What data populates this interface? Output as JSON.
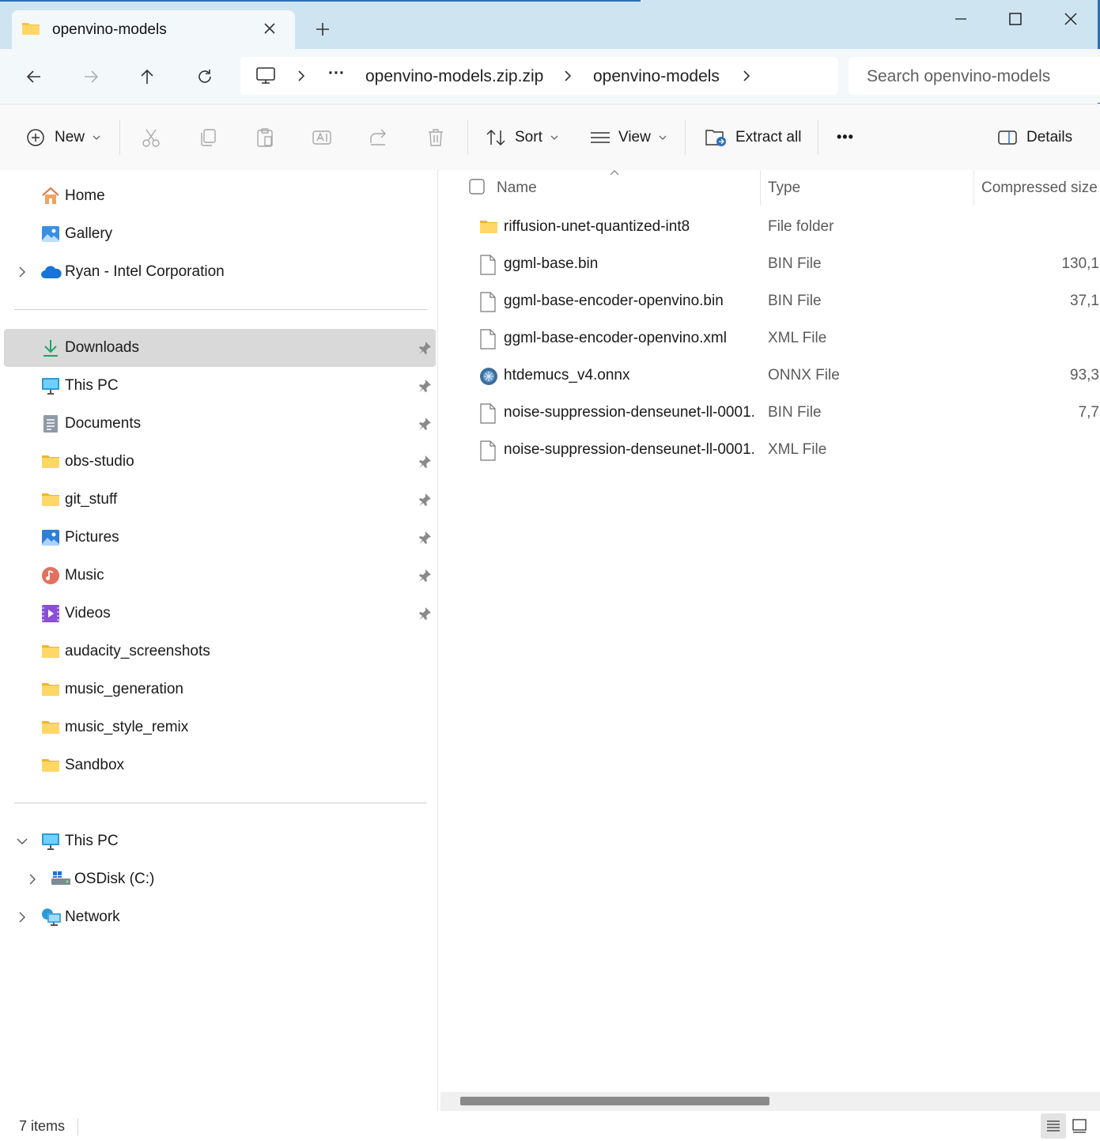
{
  "window": {
    "tab_title": "openvino-models",
    "new_tab_symbol": "+",
    "controls": [
      "minimize-icon",
      "maximize-icon",
      "close-icon"
    ]
  },
  "address": {
    "overflow": "···",
    "crumbs": [
      "openvino-models.zip.zip",
      "openvino-models"
    ],
    "search_placeholder": "Search openvino-models"
  },
  "toolbar": {
    "new_label": "New",
    "sort_label": "Sort",
    "view_label": "View",
    "extract_label": "Extract all",
    "more_label": "•••",
    "details_label": "Details"
  },
  "nav": {
    "top": [
      {
        "label": "Home",
        "icon": "home-icon"
      },
      {
        "label": "Gallery",
        "icon": "gallery-icon"
      },
      {
        "label": "Ryan - Intel Corporation",
        "icon": "onedrive-cloud-icon"
      }
    ],
    "quick": [
      {
        "label": "Downloads",
        "icon": "download-icon",
        "pinned": true,
        "selected": true
      },
      {
        "label": "This PC",
        "icon": "monitor-icon",
        "pinned": true
      },
      {
        "label": "Documents",
        "icon": "documents-icon",
        "pinned": true
      },
      {
        "label": "obs-studio",
        "icon": "folder-icon",
        "pinned": true
      },
      {
        "label": "git_stuff",
        "icon": "folder-icon",
        "pinned": true
      },
      {
        "label": "Pictures",
        "icon": "pictures-icon",
        "pinned": true
      },
      {
        "label": "Music",
        "icon": "music-icon",
        "pinned": true
      },
      {
        "label": "Videos",
        "icon": "videos-icon",
        "pinned": true
      },
      {
        "label": "audacity_screenshots",
        "icon": "folder-icon",
        "pinned": false
      },
      {
        "label": "music_generation",
        "icon": "folder-icon",
        "pinned": false
      },
      {
        "label": "music_style_remix",
        "icon": "folder-icon",
        "pinned": false
      },
      {
        "label": "Sandbox",
        "icon": "folder-icon",
        "pinned": false
      }
    ],
    "tree": [
      {
        "label": "This PC",
        "icon": "monitor-icon",
        "expanded": true
      },
      {
        "label": "OSDisk (C:)",
        "icon": "drive-icon",
        "expanded": false
      },
      {
        "label": "Network",
        "icon": "network-icon",
        "expanded": false
      }
    ]
  },
  "files": {
    "columns": [
      "Name",
      "Type",
      "Compressed size"
    ],
    "rows": [
      {
        "name": "riffusion-unet-quantized-int8",
        "type": "File folder",
        "size": "",
        "icon": "folder-icon"
      },
      {
        "name": "ggml-base.bin",
        "type": "BIN File",
        "size": "130,1",
        "icon": "file-icon"
      },
      {
        "name": "ggml-base-encoder-openvino.bin",
        "type": "BIN File",
        "size": "37,1",
        "icon": "file-icon"
      },
      {
        "name": "ggml-base-encoder-openvino.xml",
        "type": "XML File",
        "size": "",
        "icon": "file-icon"
      },
      {
        "name": "htdemucs_v4.onnx",
        "type": "ONNX File",
        "size": "93,3",
        "icon": "onnx-icon"
      },
      {
        "name": "noise-suppression-denseunet-ll-0001....",
        "type": "BIN File",
        "size": "7,7",
        "icon": "file-icon"
      },
      {
        "name": "noise-suppression-denseunet-ll-0001....",
        "type": "XML File",
        "size": "",
        "icon": "file-icon"
      }
    ]
  },
  "status": {
    "item_count": "7 items"
  },
  "colors": {
    "accent": "#2e6fb7",
    "titlebar": "#cfe4f1",
    "selection": "#d9d9d9",
    "folder": "#f6c343"
  }
}
